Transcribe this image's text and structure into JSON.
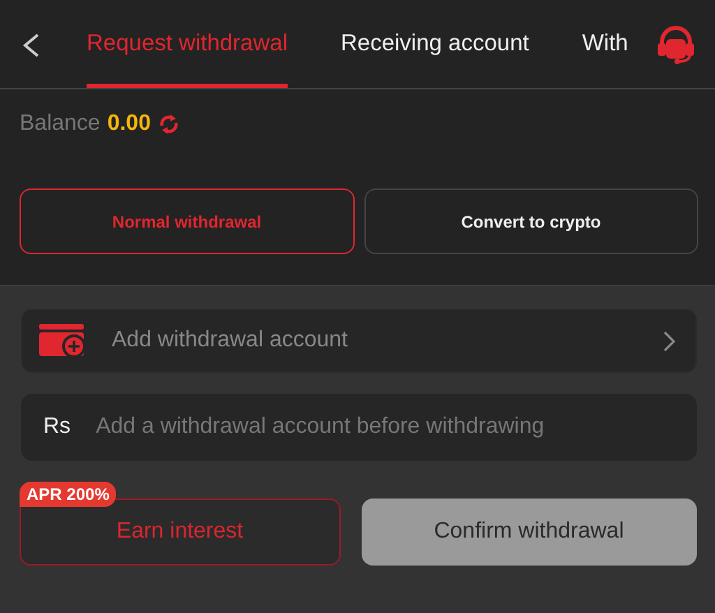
{
  "tabs": [
    {
      "label": "Request withdrawal",
      "selected": true
    },
    {
      "label": "Receiving account",
      "selected": false
    },
    {
      "label": "With",
      "selected": false
    }
  ],
  "balance": {
    "label": "Balance",
    "value": "0.00"
  },
  "modes": [
    {
      "label": "Normal withdrawal",
      "selected": true
    },
    {
      "label": "Convert to crypto",
      "selected": false
    }
  ],
  "account_row": {
    "label": "Add withdrawal account"
  },
  "amount": {
    "currency": "Rs",
    "placeholder": "Add a withdrawal account before withdrawing"
  },
  "earn_button": {
    "label": "Earn interest",
    "badge": "APR 200%"
  },
  "confirm_button": {
    "label": "Confirm withdrawal",
    "disabled": true
  }
}
